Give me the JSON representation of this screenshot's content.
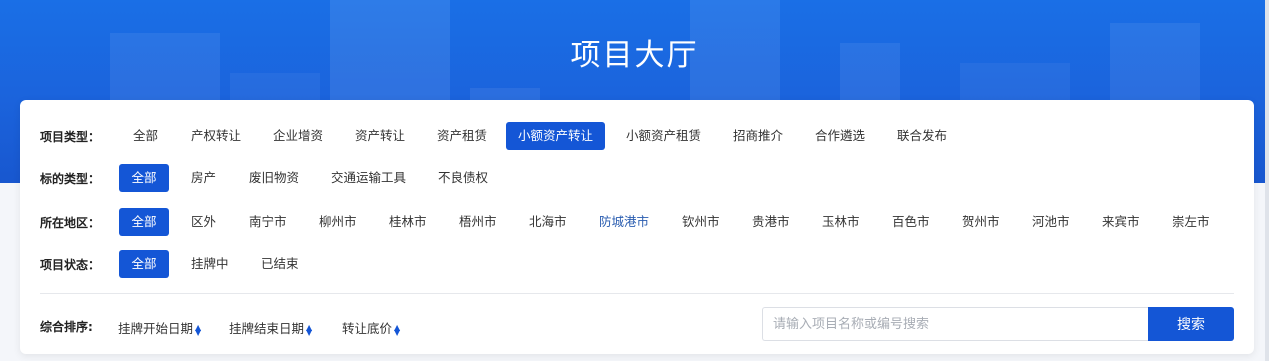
{
  "header": {
    "title": "项目大厅"
  },
  "filters": {
    "project_type": {
      "label": "项目类型：",
      "options": [
        "全部",
        "产权转让",
        "企业增资",
        "资产转让",
        "资产租赁",
        "小额资产转让",
        "小额资产租赁",
        "招商推介",
        "合作遴选",
        "联合发布"
      ],
      "selected": "小额资产转让"
    },
    "target_type": {
      "label": "标的类型：",
      "options": [
        "全部",
        "房产",
        "废旧物资",
        "交通运输工具",
        "不良债权"
      ],
      "selected": "全部"
    },
    "region": {
      "label": "所在地区：",
      "options": [
        "全部",
        "区外",
        "南宁市",
        "柳州市",
        "桂林市",
        "梧州市",
        "北海市",
        "防城港市",
        "钦州市",
        "贵港市",
        "玉林市",
        "百色市",
        "贺州市",
        "河池市",
        "来宾市",
        "崇左市"
      ],
      "selected": "全部",
      "highlighted": "防城港市"
    },
    "status": {
      "label": "项目状态：",
      "options": [
        "全部",
        "挂牌中",
        "已结束"
      ],
      "selected": "全部"
    }
  },
  "sort": {
    "label": "综合排序:",
    "options": [
      "挂牌开始日期",
      "挂牌结束日期",
      "转让底价"
    ],
    "arrow_icon": "sort-arrows-icon"
  },
  "search": {
    "placeholder": "请输入项目名称或编号搜索",
    "value": "",
    "button_label": "搜索"
  },
  "colors": {
    "accent": "#1456d6",
    "banner": "#1b63dc",
    "highlight_text": "#2a5db0"
  }
}
